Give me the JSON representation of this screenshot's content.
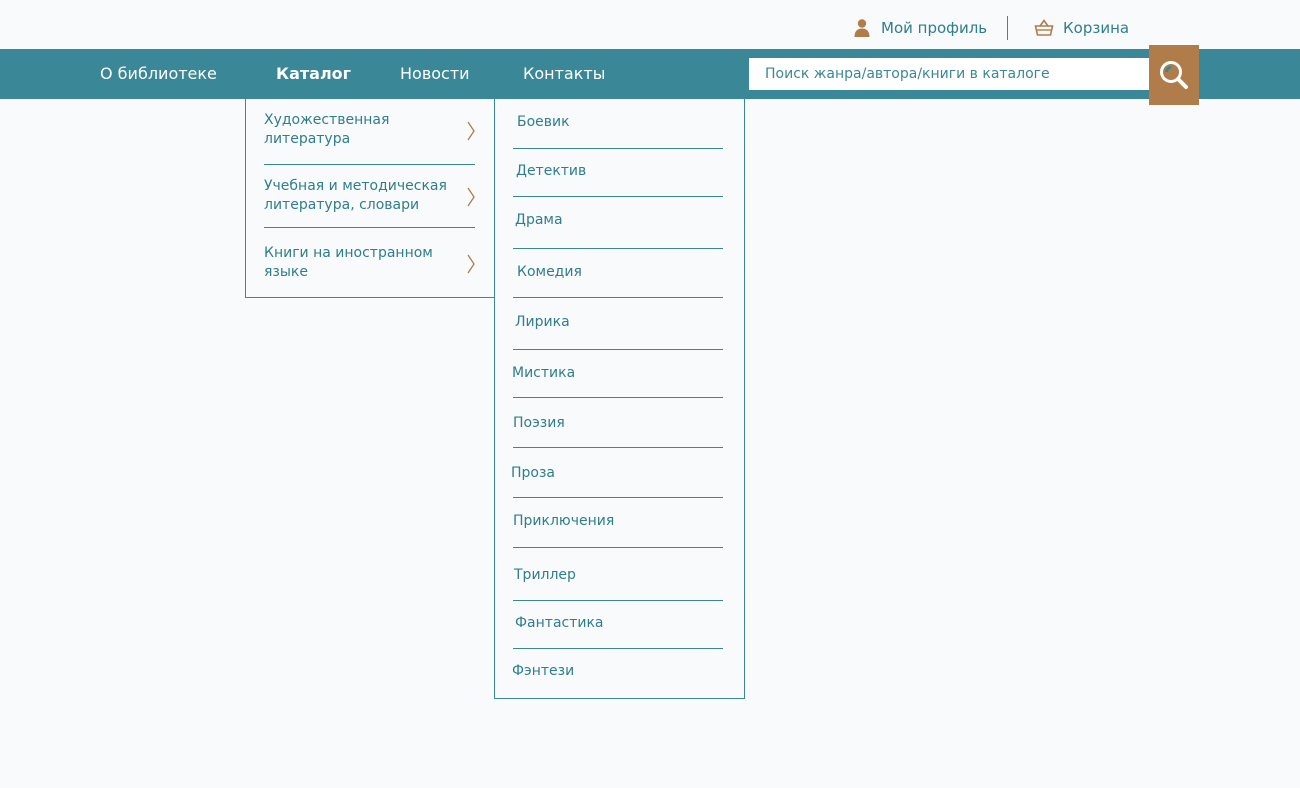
{
  "header": {
    "profile_label": "Мой профиль",
    "cart_label": "Корзина",
    "icons": {
      "profile": "user-icon",
      "cart": "basket-icon",
      "search": "magnifier-icon"
    }
  },
  "nav": {
    "items": [
      "О библиотеке",
      "Каталог",
      "Новости",
      "Контакты"
    ],
    "active": "Каталог"
  },
  "search": {
    "placeholder": "Поиск жанра/автора/книги в каталоге"
  },
  "catalog_menu": {
    "categories": [
      "Художественная литература",
      "Учебная и методическая литература, словари",
      "Книги на иностранном языке"
    ],
    "genres": [
      "Боевик",
      "Детектив",
      "Драма",
      "Комедия",
      "Лирика",
      "Мистика",
      "Поэзия",
      "Проза",
      "Приключения",
      "Триллер",
      "Фантастика",
      "Фэнтези"
    ]
  },
  "colors": {
    "primary": "#3a8797",
    "accent": "#b07c4a",
    "background": "#f8fafc",
    "text": "#2f7e8c"
  }
}
